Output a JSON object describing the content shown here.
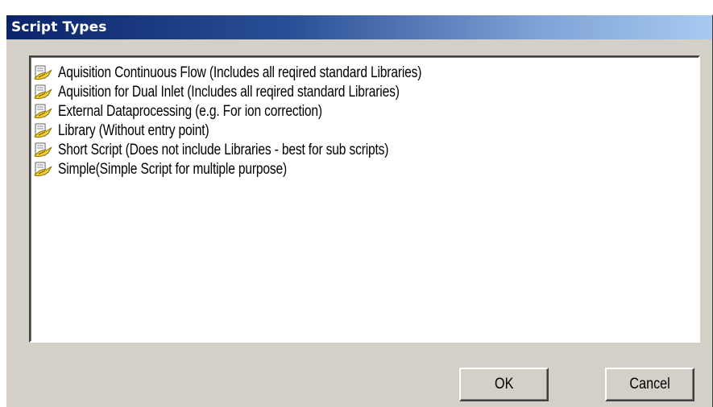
{
  "dialog": {
    "title": "Script Types"
  },
  "list": {
    "items": [
      {
        "label": "Aquisition Continuous Flow (Includes all reqired standard Libraries)",
        "icon": "script-file-icon"
      },
      {
        "label": "Aquisition for Dual Inlet (Includes all reqired standard Libraries)",
        "icon": "script-file-icon"
      },
      {
        "label": "External Dataprocessing (e.g. For ion correction)",
        "icon": "script-file-icon"
      },
      {
        "label": "Library (Without entry point)",
        "icon": "script-file-icon"
      },
      {
        "label": "Short Script (Does not include Libraries - best for sub scripts)",
        "icon": "script-file-icon"
      },
      {
        "label": "Simple(Simple Script for multiple purpose)",
        "icon": "script-file-icon"
      }
    ]
  },
  "buttons": {
    "ok_label": "OK",
    "cancel_label": "Cancel"
  },
  "colors": {
    "title_bar_start": "#0a246a",
    "title_bar_end": "#a6caf0",
    "dialog_face": "#d4d0c8"
  }
}
